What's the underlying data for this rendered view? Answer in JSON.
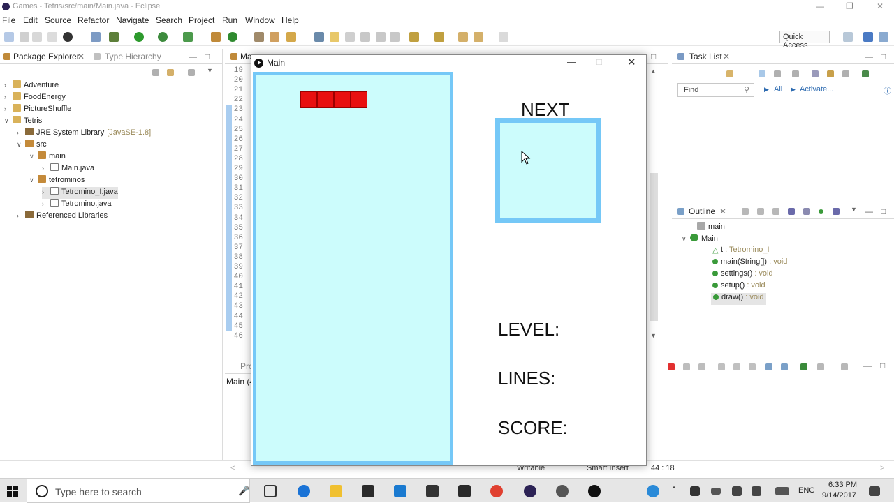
{
  "window": {
    "title": "Games - Tetris/src/main/Main.java - Eclipse"
  },
  "menu": [
    "File",
    "Edit",
    "Source",
    "Refactor",
    "Navigate",
    "Search",
    "Project",
    "Run",
    "Window",
    "Help"
  ],
  "toolbar": {
    "quick_access": "Quick Access"
  },
  "package_explorer": {
    "tab_label": "Package Explorer",
    "tab2_label": "Type Hierarchy",
    "tree": [
      {
        "label": "Adventure",
        "indent": 0,
        "arrow": ">",
        "icon": "folder"
      },
      {
        "label": "FoodEnergy",
        "indent": 0,
        "arrow": ">",
        "icon": "folder"
      },
      {
        "label": "PictureShuffle",
        "indent": 0,
        "arrow": ">",
        "icon": "folder"
      },
      {
        "label": "Tetris",
        "indent": 0,
        "arrow": "v",
        "icon": "folder"
      },
      {
        "label": "JRE System Library",
        "suffix": "[JavaSE-1.8]",
        "indent": 1,
        "arrow": ">",
        "icon": "lib"
      },
      {
        "label": "src",
        "indent": 1,
        "arrow": "v",
        "icon": "pkg"
      },
      {
        "label": "main",
        "indent": 2,
        "arrow": "v",
        "icon": "pkg"
      },
      {
        "label": "Main.java",
        "indent": 3,
        "arrow": ">",
        "icon": "java"
      },
      {
        "label": "tetrominos",
        "indent": 2,
        "arrow": "v",
        "icon": "pkg"
      },
      {
        "label": "Tetromino_I.java",
        "indent": 3,
        "arrow": ">",
        "icon": "java",
        "selected": true
      },
      {
        "label": "Tetromino.java",
        "indent": 3,
        "arrow": ">",
        "icon": "java"
      },
      {
        "label": "Referenced Libraries",
        "indent": 1,
        "arrow": ">",
        "icon": "lib"
      }
    ]
  },
  "editor": {
    "tab_label": "Ma",
    "line_numbers": [
      "19",
      "20",
      "21",
      "22",
      "23",
      "24",
      "25",
      "26",
      "27",
      "28",
      "29",
      "30",
      "31",
      "32",
      "33",
      "34",
      "35",
      "36",
      "37",
      "38",
      "39",
      "40",
      "41",
      "42",
      "43",
      "44",
      "45",
      "46"
    ]
  },
  "bottom_panel": {
    "tab_label": "Pro",
    "console_label": "Main (4"
  },
  "task_list": {
    "tab_label": "Task List",
    "find_placeholder": "Find",
    "all_label": "All",
    "activate_label": "Activate..."
  },
  "outline": {
    "tab_label": "Outline",
    "items": [
      {
        "label": "main",
        "type": ""
      },
      {
        "label": "Main",
        "type": ""
      },
      {
        "label": "t",
        "type": ": Tetromino_I"
      },
      {
        "label": "main(String[])",
        "type": ": void"
      },
      {
        "label": "settings()",
        "type": ": void"
      },
      {
        "label": "setup()",
        "type": ": void"
      },
      {
        "label": "draw()",
        "type": ": void"
      }
    ]
  },
  "processing_window": {
    "title": "Main",
    "next_label": "NEXT",
    "level_label": "LEVEL:",
    "lines_label": "LINES:",
    "score_label": "SCORE:"
  },
  "status": {
    "writable": "Writable",
    "insert_mode": "Smart Insert",
    "position": "44 : 18"
  },
  "taskbar": {
    "search_placeholder": "Type here to search",
    "language": "ENG",
    "time": "6:33 PM",
    "date": "9/14/2017"
  },
  "colors": {
    "playfield_bg": "#ccfcfc",
    "playfield_border": "#75c8f7",
    "block": "#e81010"
  }
}
